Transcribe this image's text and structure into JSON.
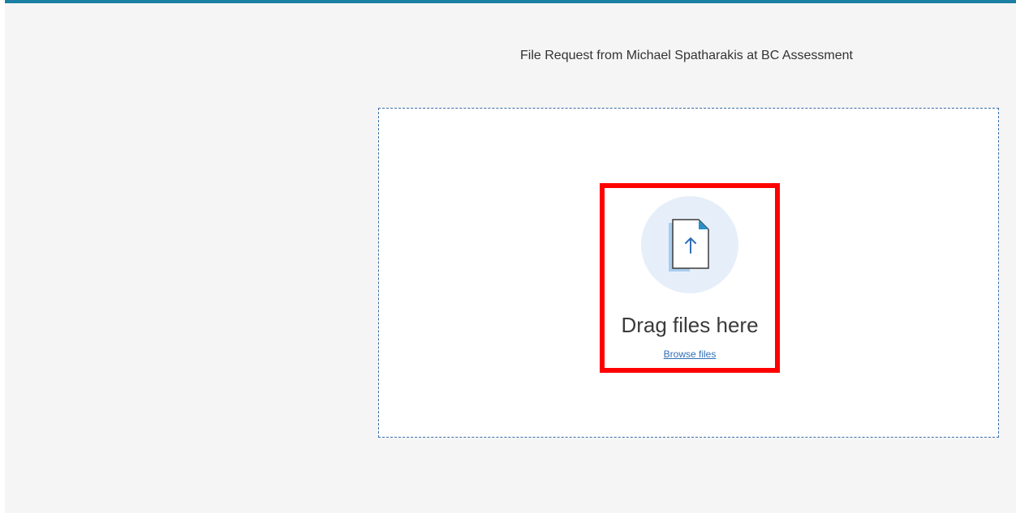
{
  "header": {
    "title": "File Request from Michael Spatharakis at BC Assessment"
  },
  "dropzone": {
    "drag_label": "Drag files here",
    "browse_label": "Browse files",
    "icon": "file-upload-icon"
  },
  "colors": {
    "accent_bar": "#1a7fa3",
    "highlight_box": "#ff0000",
    "link": "#2f6fb6",
    "dropzone_border": "#3a6ea5"
  }
}
